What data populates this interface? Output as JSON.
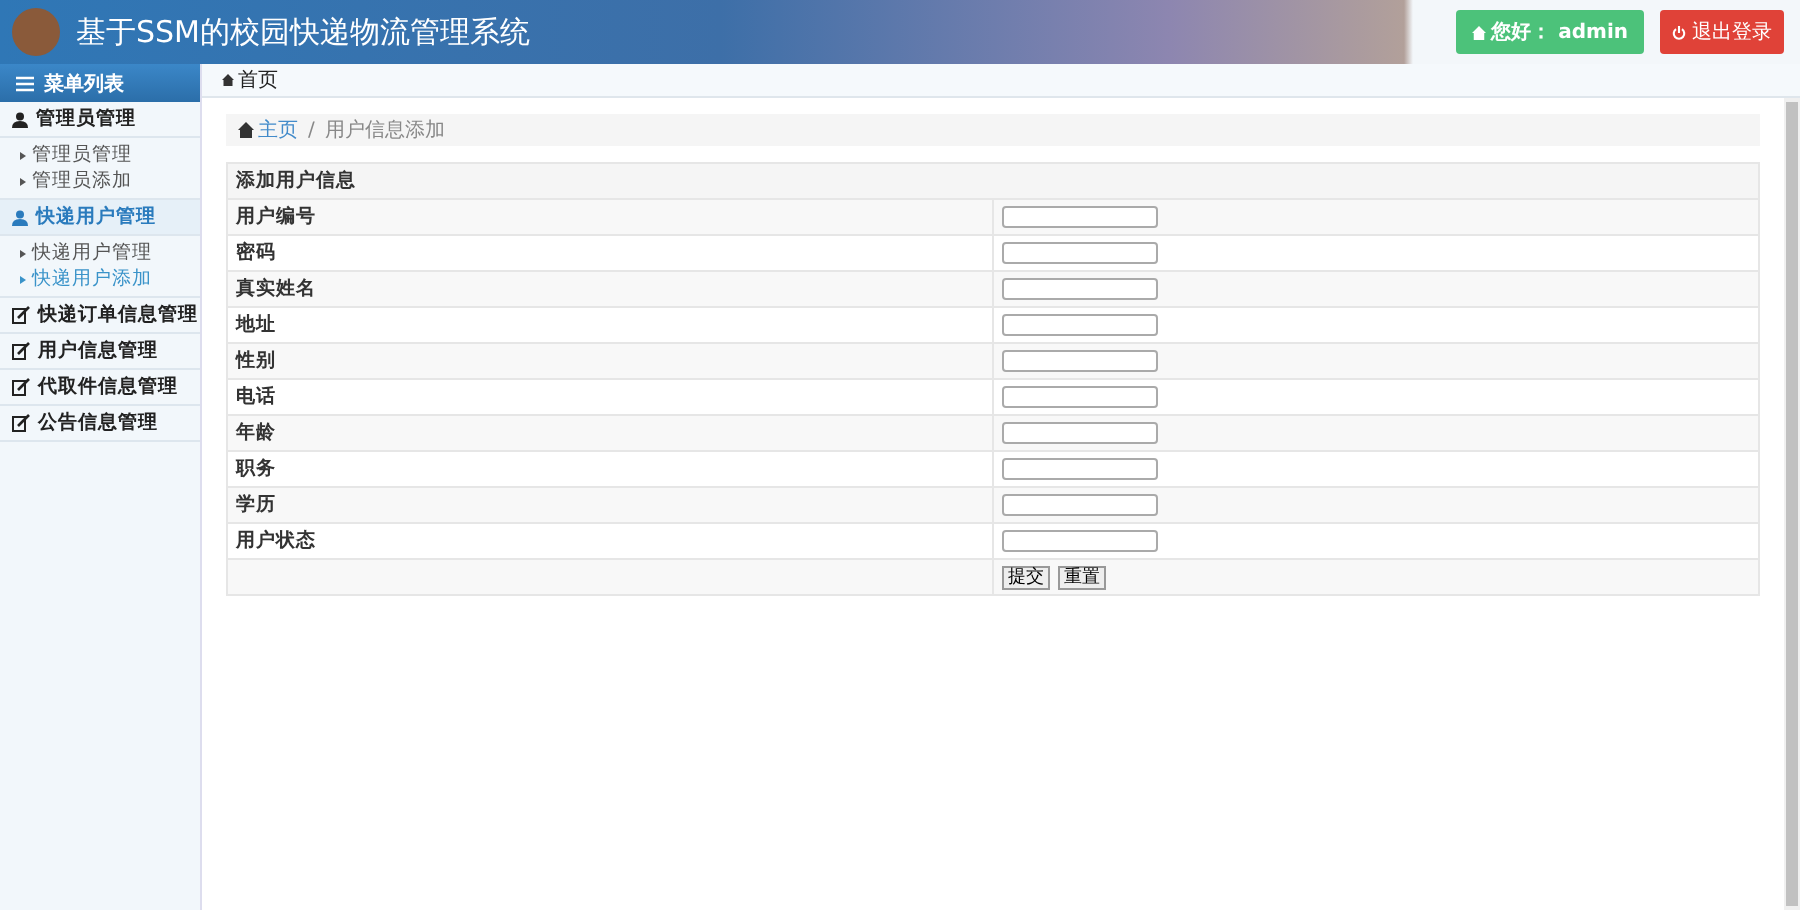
{
  "header": {
    "title": "基于SSM的校园快递物流管理系统",
    "greeting": "您好： admin",
    "logout": "退出登录"
  },
  "sidebar": {
    "title": "菜单列表",
    "groups": [
      {
        "label": "管理员管理",
        "selected": false,
        "children": [
          {
            "label": "管理员管理",
            "selected": false
          },
          {
            "label": "管理员添加",
            "selected": false
          }
        ]
      },
      {
        "label": "快递用户管理",
        "selected": true,
        "children": [
          {
            "label": "快递用户管理",
            "selected": false
          },
          {
            "label": "快递用户添加",
            "selected": true
          }
        ]
      },
      {
        "label": "快递订单信息管理",
        "selected": false
      },
      {
        "label": "用户信息管理",
        "selected": false
      },
      {
        "label": "代取件信息管理",
        "selected": false
      },
      {
        "label": "公告信息管理",
        "selected": false
      }
    ]
  },
  "tabs": [
    {
      "label": "首页",
      "selected": true
    }
  ],
  "breadcrumb": {
    "home": "主页",
    "separator": "/",
    "current": "用户信息添加"
  },
  "form": {
    "title": "添加用户信息",
    "fields": [
      {
        "label": "用户编号"
      },
      {
        "label": "密码"
      },
      {
        "label": "真实姓名"
      },
      {
        "label": "地址"
      },
      {
        "label": "性别"
      },
      {
        "label": "电话"
      },
      {
        "label": "年龄"
      },
      {
        "label": "职务"
      },
      {
        "label": "学历"
      },
      {
        "label": "用户状态"
      }
    ],
    "buttons": [
      "提交",
      "重置"
    ]
  }
}
